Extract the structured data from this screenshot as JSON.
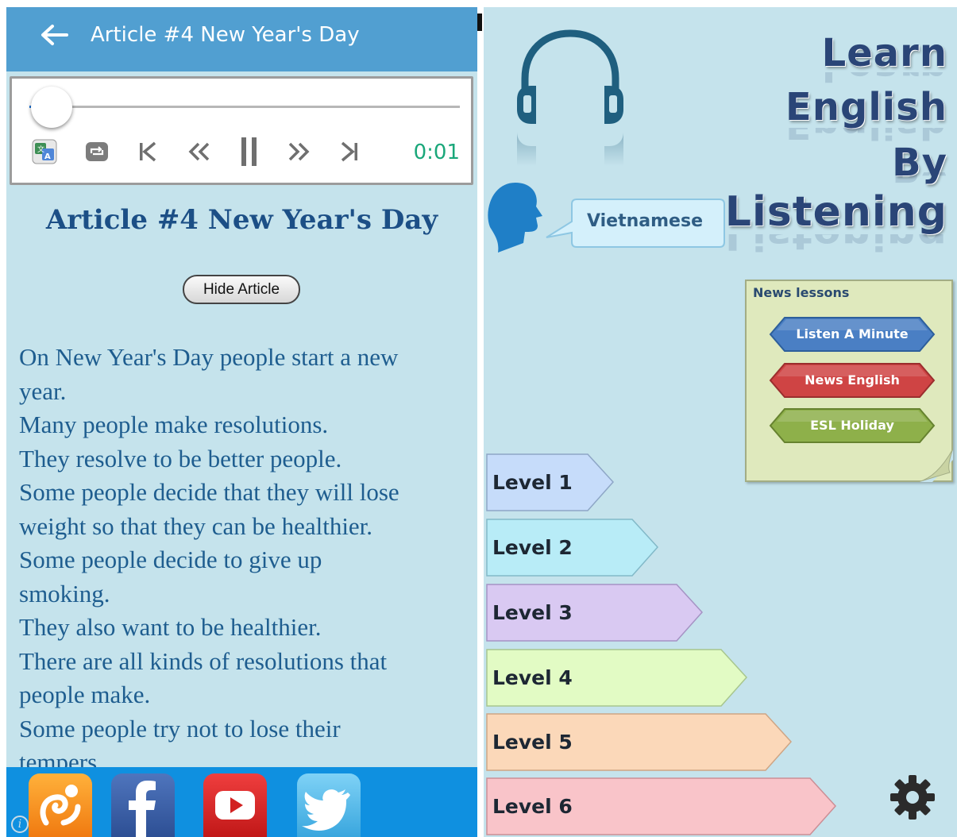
{
  "left_app": {
    "appbar": {
      "title": "Article #4 New Year's Day"
    },
    "player": {
      "progress": 0.03,
      "time": "0:01"
    },
    "article": {
      "heading": "Article #4 New Year's Day",
      "hide_button": "Hide Article",
      "body_lines": [
        "On New Year's Day people start a new",
        "year.",
        "Many people make resolutions.",
        "They resolve to be better people.",
        "Some people decide that they will lose",
        "weight so that they can be healthier.",
        "Some people decide to give up",
        "smoking.",
        "They also want to be healthier.",
        "There are all kinds of resolutions that",
        "people make.",
        "Some people try not to lose their",
        "tempers."
      ]
    },
    "social": [
      "uc-browser-icon",
      "facebook-icon",
      "youtube-icon",
      "twitter-icon"
    ],
    "info_icon": "i"
  },
  "right_app": {
    "title_lines": [
      "Learn",
      "English",
      "By",
      "Listening"
    ],
    "language_bubble": "Vietnamese",
    "news_lessons": {
      "title": "News lessons",
      "buttons": [
        {
          "label": "Listen A Minute",
          "color": "#4a7fc4"
        },
        {
          "label": "News English",
          "color": "#cf4444"
        },
        {
          "label": "ESL Holiday",
          "color": "#8eb04a"
        }
      ]
    },
    "levels": [
      {
        "label": "Level 1",
        "color": "#c6dcfa"
      },
      {
        "label": "Level 2",
        "color": "#b8ecf7"
      },
      {
        "label": "Level 3",
        "color": "#d9c9f2"
      },
      {
        "label": "Level 4",
        "color": "#e2fbc4"
      },
      {
        "label": "Level 5",
        "color": "#fbd8b9"
      },
      {
        "label": "Level 6",
        "color": "#f9c4c9"
      }
    ]
  }
}
